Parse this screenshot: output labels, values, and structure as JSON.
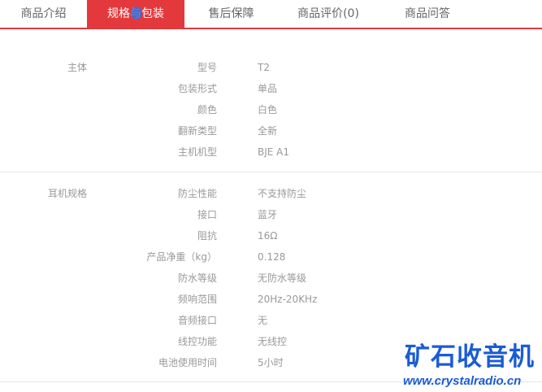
{
  "tabs": [
    {
      "label": "商品介绍",
      "active": false
    },
    {
      "label": "规格与包装",
      "active": true
    },
    {
      "label": "售后保障",
      "active": false
    },
    {
      "label": "商品评价(0)",
      "active": false
    },
    {
      "label": "商品问答",
      "active": false
    }
  ],
  "groups": [
    {
      "title": "主体",
      "rows": [
        {
          "key": "型号",
          "value": "T2"
        },
        {
          "key": "包装形式",
          "value": "单品"
        },
        {
          "key": "颜色",
          "value": "白色"
        },
        {
          "key": "翻新类型",
          "value": "全新"
        },
        {
          "key": "主机机型",
          "value": "BJE A1"
        }
      ]
    },
    {
      "title": "耳机规格",
      "rows": [
        {
          "key": "防尘性能",
          "value": "不支持防尘"
        },
        {
          "key": "接口",
          "value": "蓝牙"
        },
        {
          "key": "阻抗",
          "value": "16Ω"
        },
        {
          "key": "产品净重（kg）",
          "value": "0.128"
        },
        {
          "key": "防水等级",
          "value": "无防水等级"
        },
        {
          "key": "频响范围",
          "value": "20Hz-20KHz"
        },
        {
          "key": "音频接口",
          "value": "无"
        },
        {
          "key": "线控功能",
          "value": "无线控"
        },
        {
          "key": "电池使用时间",
          "value": "5小时"
        }
      ]
    }
  ],
  "watermark": {
    "title": "矿石收音机",
    "url": "www.crystalradio.cn"
  },
  "colors": {
    "accent": "#e4393c",
    "label_text": "#999999",
    "tab_text": "#666666",
    "watermark": "#1a5cd6"
  }
}
